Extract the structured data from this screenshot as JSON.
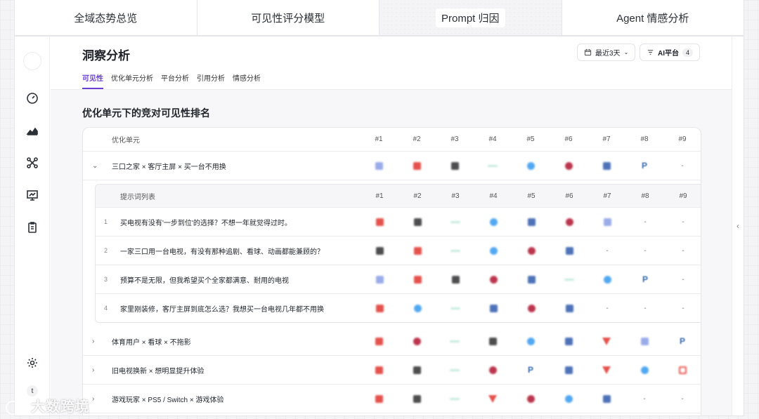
{
  "top_tabs": [
    "全域态势总览",
    "可见性评分模型",
    "Prompt 归因",
    "Agent 情感分析"
  ],
  "active_top_tab": 2,
  "page_title": "洞察分析",
  "sub_tabs": [
    "可见性",
    "优化单元分析",
    "平台分析",
    "引用分析",
    "情感分析"
  ],
  "active_sub_tab": 0,
  "controls": {
    "date_range": "最近3天",
    "platform_label": "AI平台",
    "platform_count": "4"
  },
  "section_title": "优化单元下的竞对可见性排名",
  "table_header": {
    "label": "优化单元",
    "ranks": [
      "#1",
      "#2",
      "#3",
      "#4",
      "#5",
      "#6",
      "#7",
      "#8",
      "#9"
    ]
  },
  "sub_header": {
    "label": "提示词列表",
    "ranks": [
      "#1",
      "#2",
      "#3",
      "#4",
      "#5",
      "#6",
      "#7",
      "#8",
      "#9"
    ]
  },
  "colors": {
    "red": "#e2403a",
    "dark": "#3a3a3c",
    "mint": "#bfe8dc",
    "blue": "#3f9ff0",
    "crimson": "#b3203a",
    "navy": "#3b63b0",
    "lavender": "#8fa3e6",
    "pblue": "#1e58a8",
    "accent": "#6b3fd4"
  },
  "rows": [
    {
      "label": "三口之家 × 客厅主屏 × 买一台不用换",
      "expanded": true,
      "icons": [
        "lavender",
        "red",
        "dark",
        "mint",
        "blue",
        "crimson",
        "navy",
        "pblue",
        "-"
      ]
    },
    {
      "label": "体育用户 × 看球 × 不拖影",
      "expanded": false,
      "icons": [
        "red",
        "crimson",
        "mint",
        "dark",
        "blue",
        "navy",
        "tri",
        "lavender",
        "pblue"
      ]
    },
    {
      "label": "旧电视换新 × 想明显提升体验",
      "expanded": false,
      "icons": [
        "red",
        "dark",
        "mint",
        "crimson",
        "pblue",
        "navy",
        "tri",
        "blue",
        "redo"
      ]
    },
    {
      "label": "游戏玩家 × PS5 / Switch × 游戏体验",
      "expanded": false,
      "icons": [
        "red",
        "dark",
        "mint",
        "tri",
        "crimson",
        "blue",
        "navy",
        "-",
        "-"
      ]
    }
  ],
  "prompts": [
    {
      "index": "1",
      "label": "买电视有没有'一步到位'的选择？不想一年就觉得过时。",
      "icons": [
        "red",
        "dark",
        "mint",
        "blue",
        "navy",
        "crimson",
        "lavender",
        "-",
        "-"
      ]
    },
    {
      "index": "2",
      "label": "一家三口用一台电视，有没有那种追剧、看球、动画都能兼顾的？",
      "icons": [
        "dark",
        "red",
        "mint",
        "blue",
        "crimson",
        "navy",
        "-",
        "-",
        "-"
      ]
    },
    {
      "index": "3",
      "label": "预算不是无限，但我希望买个全家都满意、耐用的电视",
      "icons": [
        "lavender",
        "red",
        "dark",
        "crimson",
        "navy",
        "mint",
        "blue",
        "pblue",
        "-"
      ]
    },
    {
      "index": "4",
      "label": "家里刚装修，客厅主屏到底怎么选？我想买一台电视几年都不用换",
      "icons": [
        "red",
        "blue",
        "mint",
        "navy",
        "crimson",
        "navy",
        "-",
        "-",
        "-"
      ]
    }
  ],
  "sidebar": {
    "avatar_letter": "t",
    "icons": [
      "gauge-icon",
      "chart-area-icon",
      "network-icon",
      "presentation-icon",
      "clipboard-icon",
      "settings-icon"
    ]
  },
  "watermark": "大数跨境"
}
